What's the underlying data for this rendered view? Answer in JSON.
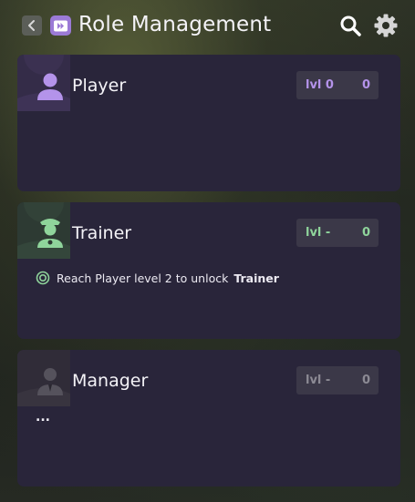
{
  "header": {
    "title": "Role Management",
    "back_icon": "chevron-left-icon",
    "app_icon": "play-badge-icon",
    "search_icon": "search-icon",
    "settings_icon": "gear-icon"
  },
  "roles": [
    {
      "name": "Player",
      "level_label": "lvl 0",
      "count": "0",
      "avatar_icon": "player-person-icon",
      "accent_color": "#b493ea"
    },
    {
      "name": "Trainer",
      "level_label": "lvl -",
      "count": "0",
      "avatar_icon": "trainer-officer-icon",
      "accent_color": "#8fd49b",
      "requirement": {
        "icon": "target-icon",
        "text": "Reach Player level 2 to unlock",
        "role": "Trainer"
      }
    },
    {
      "name": "Manager",
      "level_label": "lvl -",
      "count": "0",
      "avatar_icon": "manager-suit-icon",
      "accent_color": "#8c8a94",
      "note": "..."
    }
  ]
}
